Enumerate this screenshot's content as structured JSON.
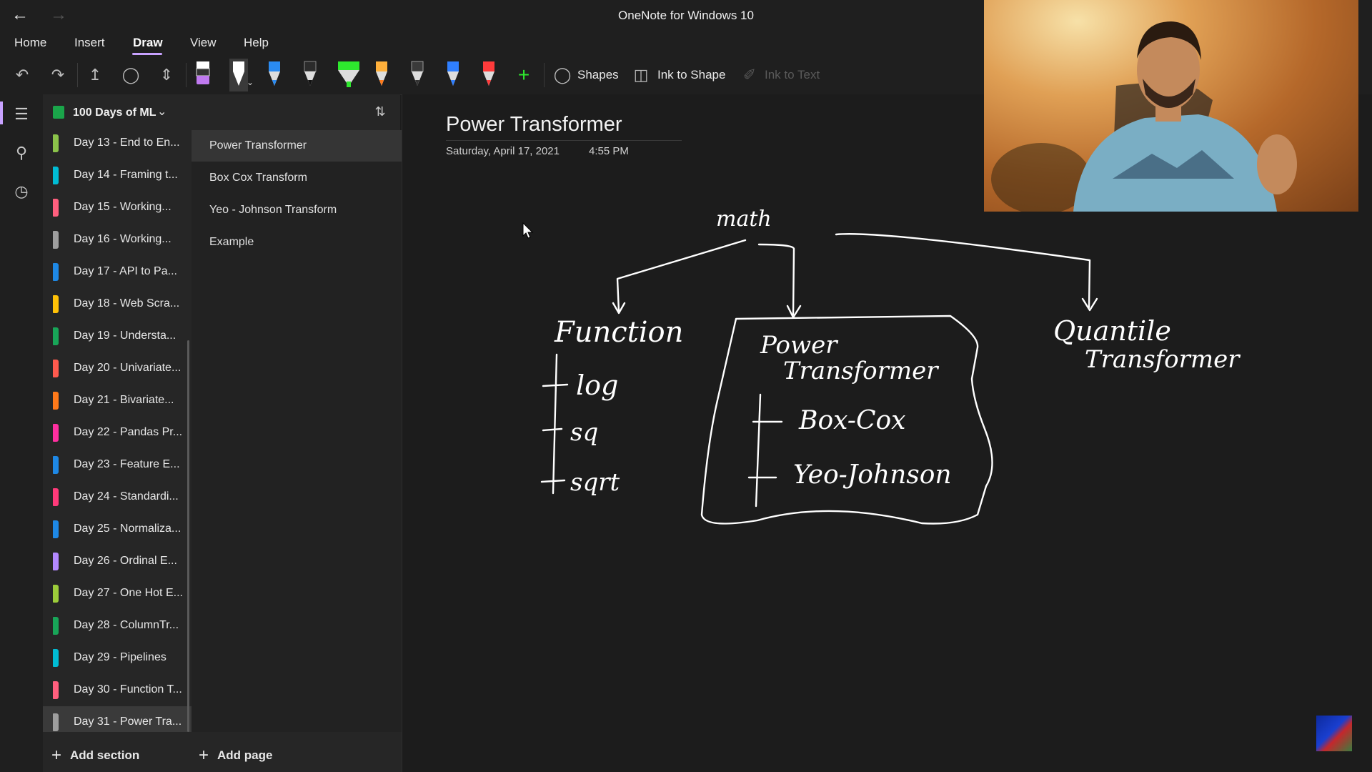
{
  "titlebar": {
    "title": "OneNote for Windows 10",
    "back_icon": "arrow-left-icon",
    "forward_icon": "arrow-right-icon"
  },
  "menu": {
    "items": [
      "Home",
      "Insert",
      "Draw",
      "View",
      "Help"
    ],
    "active": "Draw"
  },
  "ribbon": {
    "shapes_label": "Shapes",
    "ink_to_shape_label": "Ink to Shape",
    "ink_to_text_label": "Ink to Text",
    "pen_colors": [
      "#c07af0",
      "#ffffff",
      "#2a8bf2",
      "#2b2b2b",
      "#2ee82e",
      "#ffb03b",
      "#3a3a3a",
      "#2f7fff",
      "#ff3b3b"
    ]
  },
  "notebook": {
    "name": "100 Days of ML",
    "color": "#1aa54a"
  },
  "sections": [
    {
      "label": "Day 13 - End to En...",
      "color": "#8bc34a"
    },
    {
      "label": "Day 14 - Framing t...",
      "color": "#00bcd4"
    },
    {
      "label": "Day 15 - Working...",
      "color": "#ff5f7e"
    },
    {
      "label": "Day 16 - Working...",
      "color": "#9e9e9e"
    },
    {
      "label": "Day 17 - API to Pa...",
      "color": "#1e88e5"
    },
    {
      "label": "Day 18 - Web Scra...",
      "color": "#ffc107"
    },
    {
      "label": "Day 19 - Understa...",
      "color": "#18a558"
    },
    {
      "label": "Day 20 - Univariate...",
      "color": "#ff5a4e"
    },
    {
      "label": "Day 21 - Bivariate...",
      "color": "#ff7a1a"
    },
    {
      "label": "Day 22 - Pandas Pr...",
      "color": "#ff2fa0"
    },
    {
      "label": "Day 23 - Feature E...",
      "color": "#1e88e5"
    },
    {
      "label": "Day 24 - Standardi...",
      "color": "#ff3a7a"
    },
    {
      "label": "Day 25 - Normaliza...",
      "color": "#1e88e5"
    },
    {
      "label": "Day 26 - Ordinal E...",
      "color": "#b388ff"
    },
    {
      "label": "Day 27 - One Hot E...",
      "color": "#9ccc3a"
    },
    {
      "label": "Day 28 - ColumnTr...",
      "color": "#18a558"
    },
    {
      "label": "Day 29 - Pipelines",
      "color": "#00bcd4"
    },
    {
      "label": "Day 30 - Function T...",
      "color": "#ff5f7e"
    },
    {
      "label": "Day 31 - Power Tra...",
      "color": "#9e9e9e",
      "selected": true
    }
  ],
  "pages": [
    {
      "label": "Power Transformer",
      "selected": true
    },
    {
      "label": "Box Cox Transform"
    },
    {
      "label": "Yeo - Johnson Transform"
    },
    {
      "label": "Example"
    }
  ],
  "footer": {
    "add_section": "Add section",
    "add_page": "Add page"
  },
  "note": {
    "title": "Power Transformer",
    "date": "Saturday, April 17, 2021",
    "time": "4:55 PM",
    "ink": {
      "root": "math",
      "branch1": "Function",
      "branch1_items": [
        "log",
        "sq",
        "sqrt"
      ],
      "branch2_line1": "Power",
      "branch2_line2": "Transformer",
      "branch2_items": [
        "Box-Cox",
        "Yeo-Johnson"
      ],
      "branch3_line1": "Quantile",
      "branch3_line2": "Transformer"
    }
  }
}
